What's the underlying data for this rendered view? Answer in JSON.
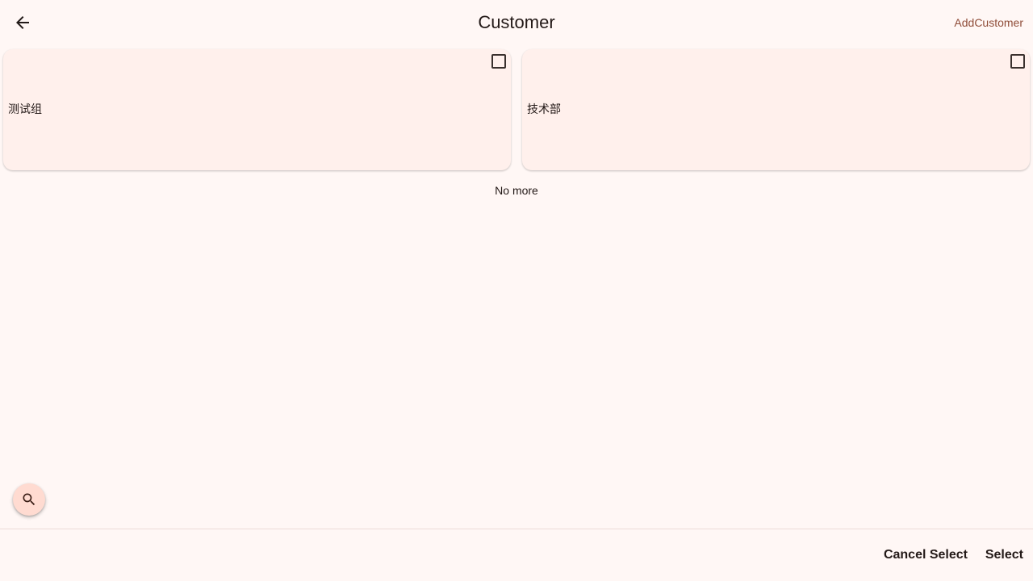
{
  "header": {
    "title": "Customer",
    "back_icon": "arrow-back-icon",
    "action_label": "AddCustomer"
  },
  "cards": [
    {
      "label": "测试组",
      "checked": false
    },
    {
      "label": "技术部",
      "checked": false
    }
  ],
  "list_end_text": "No more",
  "fab": {
    "icon": "search-icon"
  },
  "footer": {
    "cancel_label": "Cancel Select",
    "select_label": "Select"
  },
  "colors": {
    "background": "#fff7f5",
    "card": "#fff0ec",
    "accent": "#8f4c38",
    "fab": "#ffdbd1"
  }
}
